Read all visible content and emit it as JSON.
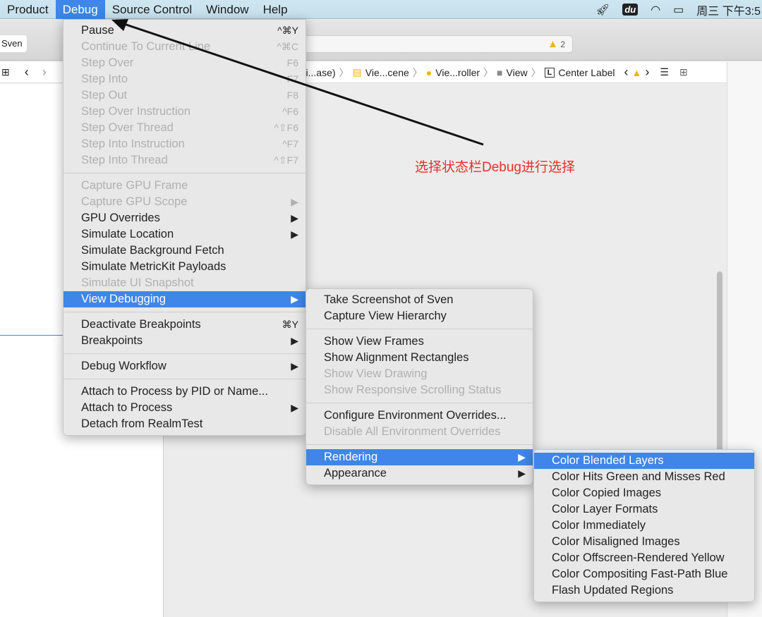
{
  "menubar": {
    "items": [
      "Product",
      "Debug",
      "Source Control",
      "Window",
      "Help"
    ],
    "active": "Debug",
    "clock": "周三 下午3:5",
    "du_label": "du"
  },
  "toolbar": {
    "scheme": "Sven",
    "warning_count": "2"
  },
  "jumpbar": {
    "crumbs": [
      "ai...ase)",
      "Vie...cene",
      "Vie...roller",
      "View",
      "Center Label"
    ],
    "label_badge": "L"
  },
  "debug_menu": [
    {
      "label": "Pause",
      "shortcut": "^⌘Y"
    },
    {
      "label": "Continue To Current Line",
      "shortcut": "^⌘C",
      "disabled": true
    },
    {
      "label": "Step Over",
      "shortcut": "F6",
      "disabled": true
    },
    {
      "label": "Step Into",
      "shortcut": "F7",
      "disabled": true
    },
    {
      "label": "Step Out",
      "shortcut": "F8",
      "disabled": true
    },
    {
      "label": "Step Over Instruction",
      "shortcut": "^F6",
      "disabled": true
    },
    {
      "label": "Step Over Thread",
      "shortcut": "^⇧F6",
      "disabled": true
    },
    {
      "label": "Step Into Instruction",
      "shortcut": "^F7",
      "disabled": true
    },
    {
      "label": "Step Into Thread",
      "shortcut": "^⇧F7",
      "disabled": true
    },
    {
      "sep": true
    },
    {
      "label": "Capture GPU Frame",
      "disabled": true
    },
    {
      "label": "Capture GPU Scope",
      "shortcut": "▶",
      "disabled": true
    },
    {
      "label": "GPU Overrides",
      "shortcut": "▶"
    },
    {
      "label": "Simulate Location",
      "shortcut": "▶"
    },
    {
      "label": "Simulate Background Fetch"
    },
    {
      "label": "Simulate MetricKit Payloads"
    },
    {
      "label": "Simulate UI Snapshot",
      "disabled": true
    },
    {
      "label": "View Debugging",
      "shortcut": "▶",
      "selected": true
    },
    {
      "sep": true
    },
    {
      "label": "Deactivate Breakpoints",
      "shortcut": "⌘Y"
    },
    {
      "label": "Breakpoints",
      "shortcut": "▶"
    },
    {
      "sep": true
    },
    {
      "label": "Debug Workflow",
      "shortcut": "▶"
    },
    {
      "sep": true
    },
    {
      "label": "Attach to Process by PID or Name..."
    },
    {
      "label": "Attach to Process",
      "shortcut": "▶"
    },
    {
      "label": "Detach from RealmTest"
    }
  ],
  "view_debugging_menu": [
    {
      "label": "Take Screenshot of Sven"
    },
    {
      "label": "Capture View Hierarchy"
    },
    {
      "sep": true
    },
    {
      "label": "Show View Frames"
    },
    {
      "label": "Show Alignment Rectangles"
    },
    {
      "label": "Show View Drawing",
      "disabled": true
    },
    {
      "label": "Show Responsive Scrolling Status",
      "disabled": true
    },
    {
      "sep": true
    },
    {
      "label": "Configure Environment Overrides..."
    },
    {
      "label": "Disable All Environment Overrides",
      "disabled": true
    },
    {
      "sep": true
    },
    {
      "label": "Rendering",
      "shortcut": "▶",
      "selected": true
    },
    {
      "label": "Appearance",
      "shortcut": "▶"
    }
  ],
  "rendering_menu": [
    {
      "label": "Color Blended Layers",
      "selected": true
    },
    {
      "label": "Color Hits Green and Misses Red"
    },
    {
      "label": "Color Copied Images"
    },
    {
      "label": "Color Layer Formats"
    },
    {
      "label": "Color Immediately"
    },
    {
      "label": "Color Misaligned Images"
    },
    {
      "label": "Color Offscreen-Rendered Yellow"
    },
    {
      "label": "Color Compositing Fast-Path Blue"
    },
    {
      "label": "Flash Updated Regions"
    }
  ],
  "annotation": "选择状态栏Debug进行选择",
  "colors": {
    "accent": "#3f86e8",
    "annotation": "#e8302a",
    "warning": "#f0b400"
  }
}
